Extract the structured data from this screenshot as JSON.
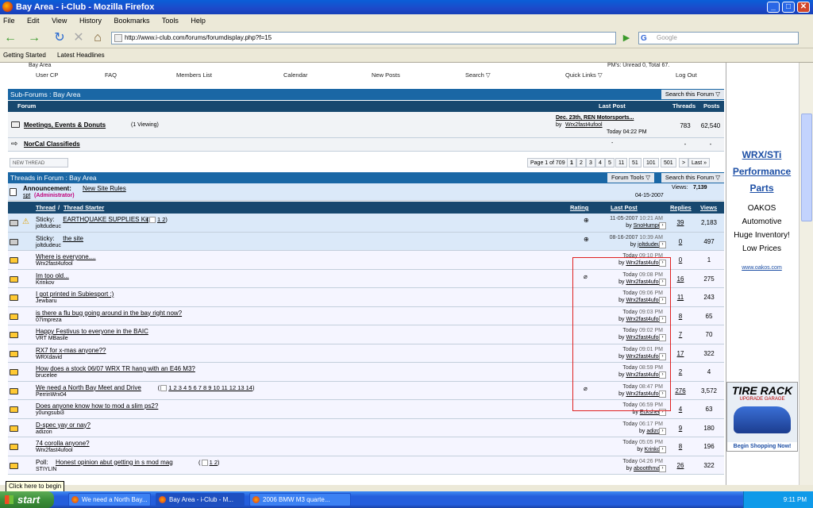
{
  "window": {
    "title": "Bay Area - i-Club - Mozilla Firefox",
    "min": "_",
    "max": "□",
    "close": "✕"
  },
  "menu": [
    "File",
    "Edit",
    "View",
    "History",
    "Bookmarks",
    "Tools",
    "Help"
  ],
  "toolbar": {
    "url": "http://www.i-club.com/forums/forumdisplay.php?f=15",
    "search_placeholder": "Google",
    "back": "←",
    "forward": "→",
    "reload": "↻",
    "stop": "✕",
    "home": "⌂",
    "go": "▶",
    "back_icon": "back-arrow-icon",
    "forward_icon": "forward-arrow-icon"
  },
  "bookmarks": [
    "Getting Started",
    "Latest Headlines"
  ],
  "forum_nav": {
    "links": [
      "User CP",
      "FAQ",
      "Members List",
      "Calendar",
      "New Posts",
      "Search ▽",
      "Quick Links ▽",
      "Log Out"
    ],
    "pm_text": "PM's: Unread 0, Total 67.",
    "crumb": "Bay Area"
  },
  "subforums": {
    "title": "Sub-Forums : Bay Area",
    "search_label": "Search this Forum ▽",
    "headers": {
      "forum": "Forum",
      "lastpost": "Last Post",
      "threads": "Threads",
      "posts": "Posts"
    },
    "rows": [
      {
        "name": "Meetings, Events & Donuts",
        "viewing": "(1 Viewing)",
        "lp_title": "Dec. 23th, REN Motorsports...",
        "lp_by": "by",
        "lp_user": "Wrx2fast4ufool",
        "lp_time": "Today 04:22 PM",
        "threads": "783",
        "posts": "62,540"
      },
      {
        "name": "NorCal Classifieds",
        "viewing": "",
        "lp_title": "-",
        "lp_by": "",
        "lp_user": "",
        "lp_time": "",
        "threads": "-",
        "posts": "-"
      }
    ]
  },
  "new_thread": "NEW THREAD",
  "pager": {
    "label": "Page 1 of 709",
    "pages": [
      "1",
      "2",
      "3",
      "4",
      "5",
      "11",
      "51",
      "101",
      "501",
      ">",
      "Last »"
    ]
  },
  "threads_bar": {
    "title": "Threads in Forum : Bay Area",
    "tools": "Forum Tools ▽",
    "search": "Search this Forum ▽"
  },
  "announcement": {
    "label": "Announcement:",
    "title": "New Site Rules",
    "user": "spt",
    "role": "(Administrator)",
    "views_label": "Views:",
    "views": "7,139",
    "date": "04-15-2007"
  },
  "thead": {
    "thread": "Thread",
    "starter": "Thread Starter",
    "rating": "Rating",
    "lastpost": "Last Post",
    "replies": "Replies",
    "views": "Views"
  },
  "threads": [
    {
      "prefix": "Sticky:",
      "title": "EARTHQUAKE SUPPLIES Kit",
      "pages": "1 2",
      "starter": "joltdudeuc",
      "date": "11-05-2007",
      "time": "10:21 AM",
      "by": "SnoHumper",
      "replies": "39",
      "views": "2,183",
      "sticky": true
    },
    {
      "prefix": "Sticky:",
      "title": "the site",
      "pages": "",
      "starter": "joltdudeuc",
      "date": "08-16-2007",
      "time": "10:39 AM",
      "by": "joltdudeuc",
      "replies": "0",
      "views": "497",
      "sticky": true
    },
    {
      "prefix": "",
      "title": "Where is everyone....",
      "pages": "",
      "starter": "Wrx2fast4ufool",
      "date": "Today",
      "time": "09:10 PM",
      "by": "Wrx2fast4ufool",
      "replies": "0",
      "views": "1"
    },
    {
      "prefix": "",
      "title": "Im too old...",
      "pages": "",
      "starter": "Krinkov",
      "date": "Today",
      "time": "09:08 PM",
      "by": "Wrx2fast4ufool",
      "replies": "16",
      "views": "275"
    },
    {
      "prefix": "",
      "title": "I got printed in Subiesport :)",
      "pages": "",
      "starter": "Jewbaru",
      "date": "Today",
      "time": "09:06 PM",
      "by": "Wrx2fast4ufool",
      "replies": "11",
      "views": "243"
    },
    {
      "prefix": "",
      "title": "is there a flu bug going around in the bay right now?",
      "pages": "",
      "starter": "07impreza",
      "date": "Today",
      "time": "09:03 PM",
      "by": "Wrx2fast4ufool",
      "replies": "8",
      "views": "65"
    },
    {
      "prefix": "",
      "title": "Happy Festivus to everyone in the BAIC",
      "pages": "",
      "starter": "VRT MBasile",
      "date": "Today",
      "time": "09:02 PM",
      "by": "Wrx2fast4ufool",
      "replies": "7",
      "views": "70"
    },
    {
      "prefix": "",
      "title": "RX7 for x-mas anyone??",
      "pages": "",
      "starter": "WRXdavid",
      "date": "Today",
      "time": "09:01 PM",
      "by": "Wrx2fast4ufool",
      "replies": "17",
      "views": "322"
    },
    {
      "prefix": "",
      "title": "How does a stock 06/07 WRX TR hang with an E46 M3?",
      "pages": "",
      "starter": "brucelee",
      "date": "Today",
      "time": "08:59 PM",
      "by": "Wrx2fast4ufool",
      "replies": "2",
      "views": "4"
    },
    {
      "prefix": "",
      "title": "We need a North Bay Meet and Drive",
      "pages": "1 2 3 4 5 6 7 8 9 10 11 12 13 14",
      "starter": "PerrinWrx04",
      "date": "Today",
      "time": "08:47 PM",
      "by": "Wrx2fast4ufool",
      "replies": "276",
      "views": "3,572"
    },
    {
      "prefix": "",
      "title": "Does anyone know how to mod a slim ps2?",
      "pages": "",
      "starter": "y0ungsubi3",
      "date": "Today",
      "time": "06:59 PM",
      "by": "Eckshero",
      "replies": "4",
      "views": "63"
    },
    {
      "prefix": "",
      "title": "D-spec yay or nay?",
      "pages": "",
      "starter": "adizon",
      "date": "Today",
      "time": "06:17 PM",
      "by": "adizon",
      "replies": "9",
      "views": "180"
    },
    {
      "prefix": "",
      "title": "74 corolla anyone?",
      "pages": "",
      "starter": "Wrx2fast4ufool",
      "date": "Today",
      "time": "05:05 PM",
      "by": "Krinkov",
      "replies": "8",
      "views": "196"
    },
    {
      "prefix": "Poll:",
      "title": "Honest opinion abut getting in s mod mag",
      "pages": "1 2",
      "starter": "STIYLIN",
      "date": "Today",
      "time": "04:26 PM",
      "by": "abootthman",
      "replies": "26",
      "views": "322"
    }
  ],
  "ad": {
    "title": "WRX/STi Performance Parts",
    "body": "OAKOS Automotive Huge Inventory! Low Prices",
    "link": "www.oakos.com",
    "banner_title": "TIRE RACK",
    "banner_sub": "UPGRADE GARAGE",
    "banner_cta": "Begin Shopping Now!"
  },
  "taskbar": {
    "start": "start",
    "tasks": [
      "We need a North Bay...",
      "Bay Area - i-Club - M...",
      "2006 BMW M3 quarte..."
    ],
    "clock": "9:11 PM"
  },
  "tooltip": "Click here to begin"
}
